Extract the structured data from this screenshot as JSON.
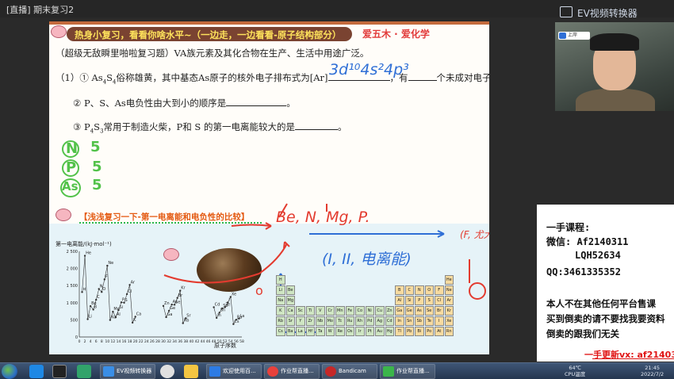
{
  "window": {
    "title": "[直播] 期末复习2"
  },
  "overlay": {
    "ev_label": "EV视频转换器"
  },
  "slide": {
    "banner": "热身小复习，看看你啥水平~（一边走，一边看看-原子结构部分）",
    "brand": "爱五木 · 爱化学",
    "intro": "（超级无敌瞬里啪啦复习题）VA族元素及其化合物在生产、生活中用途广泛。",
    "q1_a": "（1）① As",
    "q1_sub1": "4",
    "q1_mid": "S",
    "q1_sub2": "4",
    "q1_b": "俗称雄黄，其中基态As原子的核外电子排布式为[Ar]",
    "q1_c": "，有",
    "q1_d": "个未成对电子。",
    "q2": "② P、S、As电负性由大到小的顺序是",
    "q3_a": "③ P",
    "q3_sub1": "4",
    "q3_mid": "S",
    "q3_sub2": "3",
    "q3_b": "常用于制造火柴，P和 S 的第一电离能较大的是",
    "hw_config": "3d¹⁰4s²4p³",
    "hw_n": "N",
    "hw_p": "P",
    "hw_as": "As",
    "hw_5a": "5",
    "hw_5b": "5",
    "hw_5c": "5",
    "section_title": "【浅浅复习一下-第一电离能和电负性的比较】",
    "hw_elements": "Be, N, Mg, P.",
    "hw_exception": "(I, II, 电离能)",
    "hw_right": "(F, 尤大)",
    "chart_title": "第一电离能/(kJ·mol⁻¹)",
    "chart_xlabel": "原子序数"
  },
  "chart_data": {
    "type": "line",
    "title": "第一电离能/(kJ·mol⁻¹)",
    "xlabel": "原子序数",
    "ylabel": "第一电离能/(kJ·mol⁻¹)",
    "x": [
      1,
      2,
      3,
      4,
      5,
      6,
      7,
      8,
      9,
      10,
      11,
      12,
      13,
      14,
      15,
      16,
      17,
      18,
      19,
      20,
      30,
      31,
      32,
      33,
      34,
      35,
      36,
      37,
      38,
      48,
      49,
      50,
      51,
      52,
      53,
      54,
      55,
      56,
      57
    ],
    "series": [
      {
        "name": "",
        "values": [
          1312,
          2372,
          520,
          900,
          801,
          1086,
          1402,
          1314,
          1681,
          2081,
          496,
          738,
          578,
          787,
          1012,
          1000,
          1251,
          1521,
          419,
          590,
          906,
          579,
          762,
          947,
          941,
          1140,
          1351,
          403,
          549,
          868,
          558,
          709,
          834,
          869,
          1008,
          1170,
          376,
          503,
          538
        ]
      }
    ],
    "ylim": [
      0,
      2500
    ],
    "yticks": [
      "2 500",
      "2 000",
      "1 500",
      "1 000",
      "500",
      "0"
    ],
    "xticks": [
      "0",
      "2",
      "4",
      "6",
      "8",
      "10",
      "12",
      "14",
      "16",
      "18",
      "20",
      "22",
      "24",
      "26",
      "28",
      "30",
      "32",
      "34",
      "36",
      "38",
      "40",
      "42",
      "44",
      "46",
      "48",
      "50",
      "52",
      "54",
      "56",
      "58"
    ],
    "point_labels": [
      {
        "label": "H",
        "x": 1
      },
      {
        "label": "He",
        "x": 2
      },
      {
        "label": "Li",
        "x": 3
      },
      {
        "label": "Be",
        "x": 4
      },
      {
        "label": "B",
        "x": 5
      },
      {
        "label": "C",
        "x": 6
      },
      {
        "label": "N",
        "x": 7
      },
      {
        "label": "O",
        "x": 8
      },
      {
        "label": "F",
        "x": 9
      },
      {
        "label": "Ne",
        "x": 10
      },
      {
        "label": "Na",
        "x": 11
      },
      {
        "label": "Mg",
        "x": 12
      },
      {
        "label": "Al",
        "x": 13
      },
      {
        "label": "Si",
        "x": 14
      },
      {
        "label": "P",
        "x": 15
      },
      {
        "label": "S",
        "x": 16
      },
      {
        "label": "Cl",
        "x": 17
      },
      {
        "label": "Ar",
        "x": 18
      },
      {
        "label": "K",
        "x": 19
      },
      {
        "label": "Ca",
        "x": 20
      },
      {
        "label": "Zn",
        "x": 30
      },
      {
        "label": "Ga",
        "x": 31
      },
      {
        "label": "Ge",
        "x": 32
      },
      {
        "label": "As",
        "x": 33
      },
      {
        "label": "Se",
        "x": 34
      },
      {
        "label": "Br",
        "x": 35
      },
      {
        "label": "Kr",
        "x": 36
      },
      {
        "label": "Rb",
        "x": 37
      },
      {
        "label": "Sr",
        "x": 38
      },
      {
        "label": "Cd",
        "x": 48
      },
      {
        "label": "In",
        "x": 49
      },
      {
        "label": "Sn",
        "x": 50
      },
      {
        "label": "Sb",
        "x": 51
      },
      {
        "label": "Te",
        "x": 52
      },
      {
        "label": "I",
        "x": 53
      },
      {
        "label": "Xe",
        "x": 54
      },
      {
        "label": "Cs",
        "x": 55
      },
      {
        "label": "Ba",
        "x": 56
      },
      {
        "label": "La",
        "x": 57
      }
    ]
  },
  "ptable": {
    "cells": [
      {
        "s": "H",
        "c": 0,
        "r": 0
      },
      {
        "s": "Li",
        "c": 0,
        "r": 1
      },
      {
        "s": "Be",
        "c": 1,
        "r": 1
      },
      {
        "s": "Na",
        "c": 0,
        "r": 2
      },
      {
        "s": "Mg",
        "c": 1,
        "r": 2
      },
      {
        "s": "K",
        "c": 0,
        "r": 3
      },
      {
        "s": "Ca",
        "c": 1,
        "r": 3
      },
      {
        "s": "Sc",
        "c": 2,
        "r": 3
      },
      {
        "s": "Ti",
        "c": 3,
        "r": 3
      },
      {
        "s": "V",
        "c": 4,
        "r": 3
      },
      {
        "s": "Cr",
        "c": 5,
        "r": 3
      },
      {
        "s": "Mn",
        "c": 6,
        "r": 3
      },
      {
        "s": "Fe",
        "c": 7,
        "r": 3
      },
      {
        "s": "Co",
        "c": 8,
        "r": 3
      },
      {
        "s": "Ni",
        "c": 9,
        "r": 3
      },
      {
        "s": "Cu",
        "c": 10,
        "r": 3
      },
      {
        "s": "Zn",
        "c": 11,
        "r": 3
      },
      {
        "s": "Rb",
        "c": 0,
        "r": 4
      },
      {
        "s": "Sr",
        "c": 1,
        "r": 4
      },
      {
        "s": "Y",
        "c": 2,
        "r": 4
      },
      {
        "s": "Zr",
        "c": 3,
        "r": 4
      },
      {
        "s": "Nb",
        "c": 4,
        "r": 4
      },
      {
        "s": "Mo",
        "c": 5,
        "r": 4
      },
      {
        "s": "Tc",
        "c": 6,
        "r": 4
      },
      {
        "s": "Ru",
        "c": 7,
        "r": 4
      },
      {
        "s": "Rh",
        "c": 8,
        "r": 4
      },
      {
        "s": "Pd",
        "c": 9,
        "r": 4
      },
      {
        "s": "Ag",
        "c": 10,
        "r": 4
      },
      {
        "s": "Cd",
        "c": 11,
        "r": 4
      },
      {
        "s": "Cs",
        "c": 0,
        "r": 5
      },
      {
        "s": "Ba",
        "c": 1,
        "r": 5
      },
      {
        "s": "La",
        "c": 2,
        "r": 5
      },
      {
        "s": "Hf",
        "c": 3,
        "r": 5
      },
      {
        "s": "Ta",
        "c": 4,
        "r": 5
      },
      {
        "s": "W",
        "c": 5,
        "r": 5
      },
      {
        "s": "Re",
        "c": 6,
        "r": 5
      },
      {
        "s": "Os",
        "c": 7,
        "r": 5
      },
      {
        "s": "Ir",
        "c": 8,
        "r": 5
      },
      {
        "s": "Pt",
        "c": 9,
        "r": 5
      },
      {
        "s": "Au",
        "c": 10,
        "r": 5
      },
      {
        "s": "Hg",
        "c": 11,
        "r": 5
      },
      {
        "s": "B",
        "c": 12,
        "r": 1,
        "p": true
      },
      {
        "s": "C",
        "c": 13,
        "r": 1,
        "p": true
      },
      {
        "s": "N",
        "c": 14,
        "r": 1,
        "p": true
      },
      {
        "s": "O",
        "c": 15,
        "r": 1,
        "p": true
      },
      {
        "s": "F",
        "c": 16,
        "r": 1,
        "p": true
      },
      {
        "s": "Ne",
        "c": 17,
        "r": 1,
        "p": true
      },
      {
        "s": "Al",
        "c": 12,
        "r": 2,
        "p": true
      },
      {
        "s": "Si",
        "c": 13,
        "r": 2,
        "p": true
      },
      {
        "s": "P",
        "c": 14,
        "r": 2,
        "p": true
      },
      {
        "s": "S",
        "c": 15,
        "r": 2,
        "p": true
      },
      {
        "s": "Cl",
        "c": 16,
        "r": 2,
        "p": true
      },
      {
        "s": "Ar",
        "c": 17,
        "r": 2,
        "p": true
      },
      {
        "s": "Ga",
        "c": 12,
        "r": 3,
        "p": true
      },
      {
        "s": "Ge",
        "c": 13,
        "r": 3,
        "p": true
      },
      {
        "s": "As",
        "c": 14,
        "r": 3,
        "p": true
      },
      {
        "s": "Se",
        "c": 15,
        "r": 3,
        "p": true
      },
      {
        "s": "Br",
        "c": 16,
        "r": 3,
        "p": true
      },
      {
        "s": "Kr",
        "c": 17,
        "r": 3,
        "p": true
      },
      {
        "s": "In",
        "c": 12,
        "r": 4,
        "p": true
      },
      {
        "s": "Sn",
        "c": 13,
        "r": 4,
        "p": true
      },
      {
        "s": "Sb",
        "c": 14,
        "r": 4,
        "p": true
      },
      {
        "s": "Te",
        "c": 15,
        "r": 4,
        "p": true
      },
      {
        "s": "I",
        "c": 16,
        "r": 4,
        "p": true
      },
      {
        "s": "Xe",
        "c": 17,
        "r": 4,
        "p": true
      },
      {
        "s": "Tl",
        "c": 12,
        "r": 5,
        "p": true
      },
      {
        "s": "Pb",
        "c": 13,
        "r": 5,
        "p": true
      },
      {
        "s": "Bi",
        "c": 14,
        "r": 5,
        "p": true
      },
      {
        "s": "Po",
        "c": 15,
        "r": 5,
        "p": true
      },
      {
        "s": "At",
        "c": 16,
        "r": 5,
        "p": true
      },
      {
        "s": "Rn",
        "c": 17,
        "r": 5,
        "p": true
      },
      {
        "s": "He",
        "c": 17,
        "r": 0,
        "p": true
      }
    ]
  },
  "webcam": {
    "badge": "上岸"
  },
  "ad": {
    "l1": "一手课程:",
    "l2": "微信: Af2140311",
    "l3": "LQH52634",
    "l4": "QQ:3461335352",
    "l5": "本人不在其他任何平台售课",
    "l6": "买到倒卖的请不要找我要资料",
    "l7": "倒卖的跟我们无关",
    "l8": "一手更新vx: af21403"
  },
  "taskbar": {
    "items": [
      {
        "label": "EV视频转换器",
        "color": "#3a8ee6"
      },
      {
        "label": "欢迎使用百...",
        "color": "#2c7be5"
      },
      {
        "label": "作业帮直播...",
        "color": "#e8413c"
      },
      {
        "label": "Bandicam",
        "color": "#c62828"
      },
      {
        "label": "作业帮直播...",
        "color": "#3bb54a"
      }
    ],
    "temp": "64℃",
    "cpu": "CPU温度",
    "time": "21:45",
    "date": "2022/7/2"
  },
  "colors": {
    "accent_blue": "#2f6fd6",
    "hw_green": "#52c24a",
    "hw_red": "#e33b2f",
    "banner_bg": "#7a4331"
  }
}
